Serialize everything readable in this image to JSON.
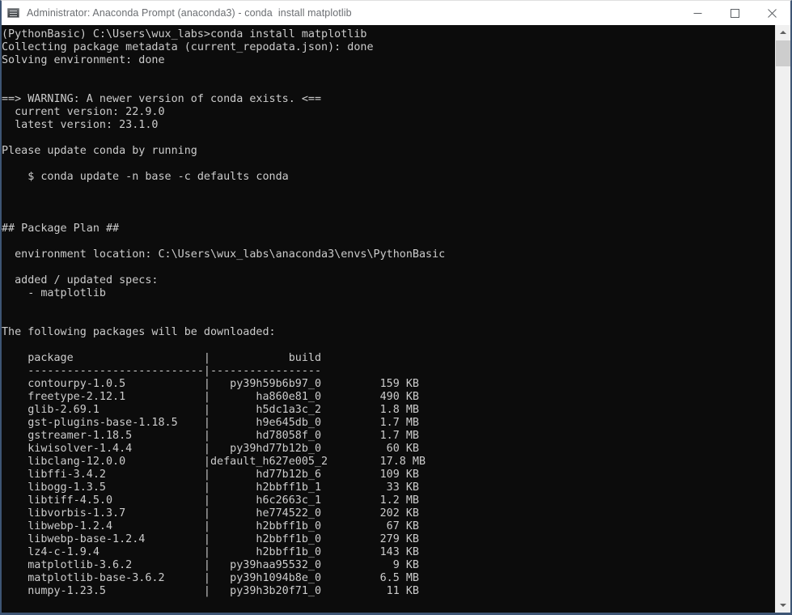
{
  "window": {
    "title": "Administrator: Anaconda Prompt (anaconda3) - conda  install matplotlib",
    "icon": "console-icon",
    "controls": {
      "minimize_label": "Minimize",
      "maximize_label": "Maximize",
      "close_label": "Close"
    },
    "colors": {
      "titlebar_bg": "#ffffff",
      "titlebar_text": "#6b6e72",
      "frame_border": "#3e5574",
      "console_bg": "#0c0c0c",
      "console_text": "#cccccc",
      "scrollbar_track": "#f0f0f0",
      "scrollbar_thumb": "#cdcdcd"
    }
  },
  "scrollbar": {
    "orientation": "vertical",
    "up_arrow": "chevron-up-icon",
    "down_arrow": "chevron-down-icon",
    "thumb_position": "top"
  },
  "terminal": {
    "prompt_env": "(PythonBasic)",
    "prompt_path": "C:\\Users\\wux_labs",
    "command": "conda install matplotlib",
    "conda_current_version": "22.9.0",
    "conda_latest_version": "23.1.0",
    "environment_location": "C:\\Users\\wux_labs\\anaconda3\\envs\\PythonBasic",
    "added_updated_specs": [
      "matplotlib"
    ],
    "table_headers": {
      "package": "package",
      "build": "build"
    },
    "packages": [
      {
        "package": "contourpy-1.0.5",
        "build": "py39h59b6b97_0",
        "size": "159 KB"
      },
      {
        "package": "freetype-2.12.1",
        "build": "ha860e81_0",
        "size": "490 KB"
      },
      {
        "package": "glib-2.69.1",
        "build": "h5dc1a3c_2",
        "size": "1.8 MB"
      },
      {
        "package": "gst-plugins-base-1.18.5",
        "build": "h9e645db_0",
        "size": "1.7 MB"
      },
      {
        "package": "gstreamer-1.18.5",
        "build": "hd78058f_0",
        "size": "1.7 MB"
      },
      {
        "package": "kiwisolver-1.4.4",
        "build": "py39hd77b12b_0",
        "size": "60 KB"
      },
      {
        "package": "libclang-12.0.0",
        "build": "default_h627e005_2",
        "size": "17.8 MB"
      },
      {
        "package": "libffi-3.4.2",
        "build": "hd77b12b_6",
        "size": "109 KB"
      },
      {
        "package": "libogg-1.3.5",
        "build": "h2bbff1b_1",
        "size": "33 KB"
      },
      {
        "package": "libtiff-4.5.0",
        "build": "h6c2663c_1",
        "size": "1.2 MB"
      },
      {
        "package": "libvorbis-1.3.7",
        "build": "he774522_0",
        "size": "202 KB"
      },
      {
        "package": "libwebp-1.2.4",
        "build": "h2bbff1b_0",
        "size": "67 KB"
      },
      {
        "package": "libwebp-base-1.2.4",
        "build": "h2bbff1b_0",
        "size": "279 KB"
      },
      {
        "package": "lz4-c-1.9.4",
        "build": "h2bbff1b_0",
        "size": "143 KB"
      },
      {
        "package": "matplotlib-3.6.2",
        "build": "py39haa95532_0",
        "size": "9 KB"
      },
      {
        "package": "matplotlib-base-3.6.2",
        "build": "py39h1094b8e_0",
        "size": "6.5 MB"
      },
      {
        "package": "numpy-1.23.5",
        "build": "py39h3b20f71_0",
        "size": "11 KB"
      }
    ],
    "output": "(PythonBasic) C:\\Users\\wux_labs>conda install matplotlib\nCollecting package metadata (current_repodata.json): done\nSolving environment: done\n\n\n==> WARNING: A newer version of conda exists. <==\n  current version: 22.9.0\n  latest version: 23.1.0\n\nPlease update conda by running\n\n    $ conda update -n base -c defaults conda\n\n\n\n## Package Plan ##\n\n  environment location: C:\\Users\\wux_labs\\anaconda3\\envs\\PythonBasic\n\n  added / updated specs:\n    - matplotlib\n\n\nThe following packages will be downloaded:\n\n    package                    |            build\n    ---------------------------|-----------------\n    contourpy-1.0.5            |   py39h59b6b97_0         159 KB\n    freetype-2.12.1            |       ha860e81_0         490 KB\n    glib-2.69.1                |       h5dc1a3c_2         1.8 MB\n    gst-plugins-base-1.18.5    |       h9e645db_0         1.7 MB\n    gstreamer-1.18.5           |       hd78058f_0         1.7 MB\n    kiwisolver-1.4.4           |   py39hd77b12b_0          60 KB\n    libclang-12.0.0            |default_h627e005_2        17.8 MB\n    libffi-3.4.2               |       hd77b12b_6         109 KB\n    libogg-1.3.5               |       h2bbff1b_1          33 KB\n    libtiff-4.5.0              |       h6c2663c_1         1.2 MB\n    libvorbis-1.3.7            |       he774522_0         202 KB\n    libwebp-1.2.4              |       h2bbff1b_0          67 KB\n    libwebp-base-1.2.4         |       h2bbff1b_0         279 KB\n    lz4-c-1.9.4                |       h2bbff1b_0         143 KB\n    matplotlib-3.6.2           |   py39haa95532_0           9 KB\n    matplotlib-base-3.6.2      |   py39h1094b8e_0         6.5 MB\n    numpy-1.23.5               |   py39h3b20f71_0          11 KB"
  }
}
